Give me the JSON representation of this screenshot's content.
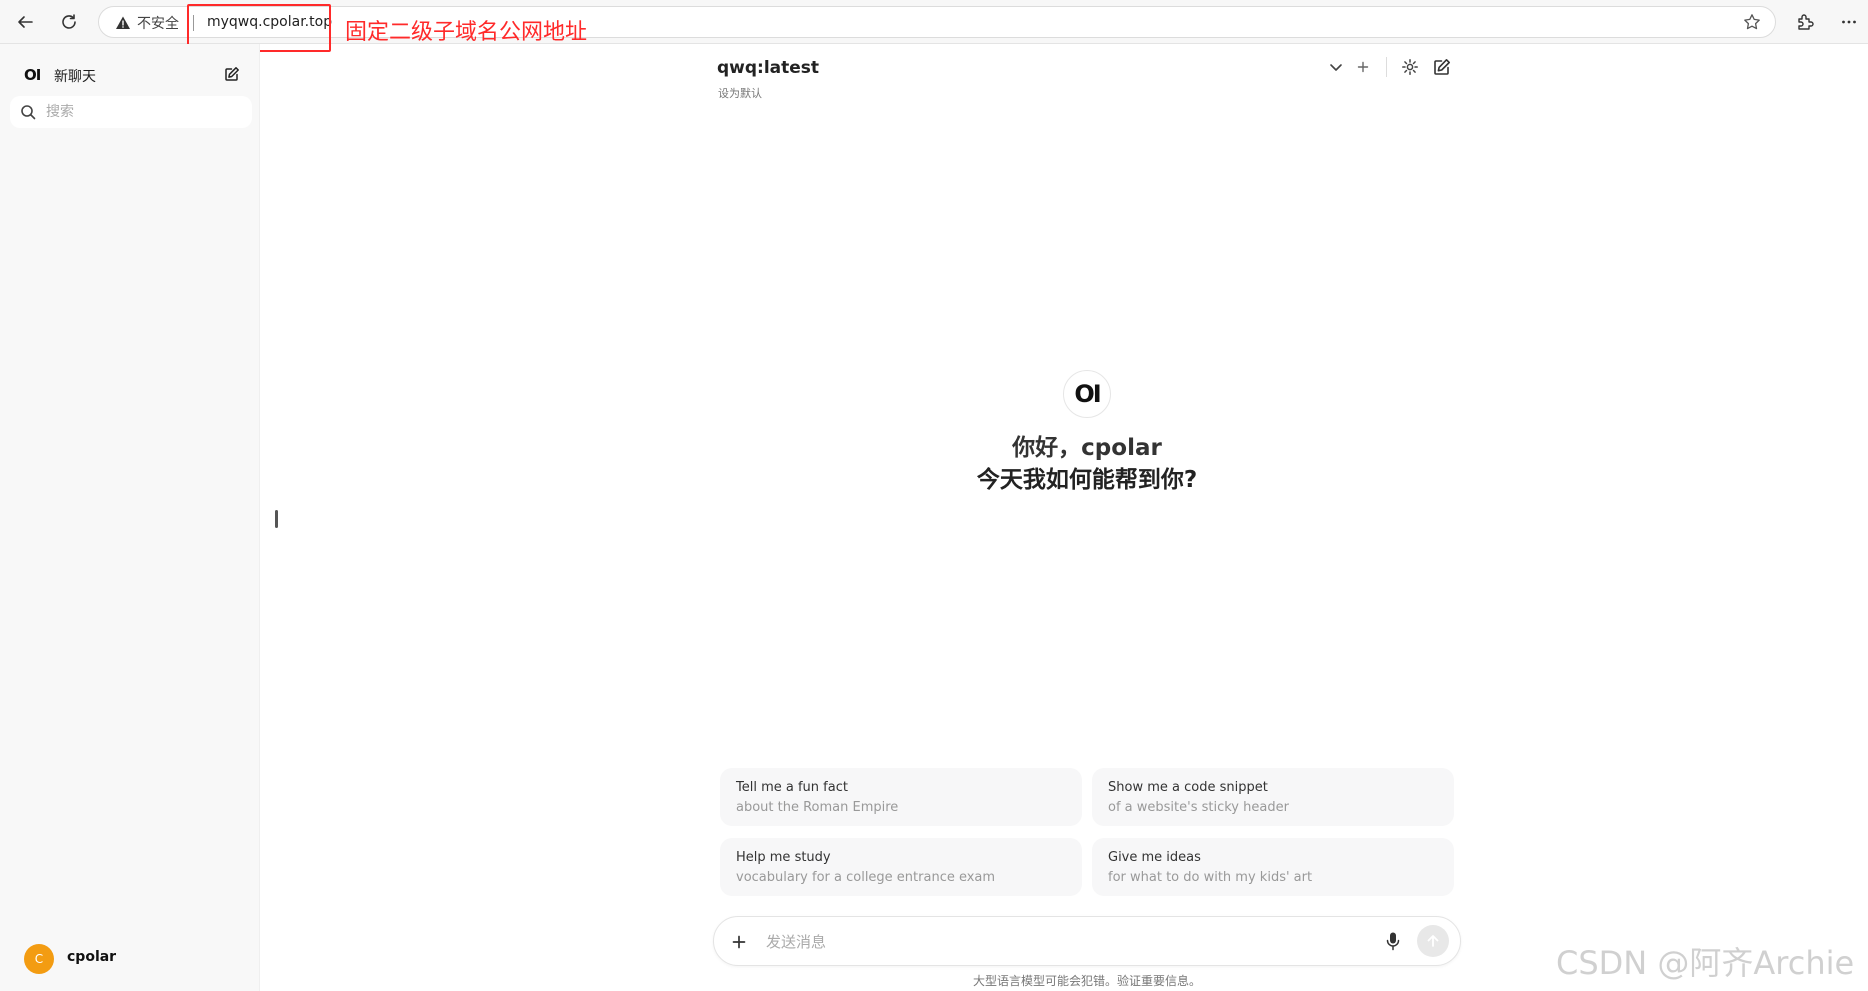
{
  "browser": {
    "insecure_label": "不安全",
    "url": "myqwq.cpolar.top",
    "annotation": "固定二级子域名公网地址"
  },
  "sidebar": {
    "logo": "OI",
    "new_chat_label": "新聊天",
    "search_placeholder": "搜索",
    "user": {
      "avatar_initial": "C",
      "name": "cpolar",
      "avatar_color": "#f39c12"
    }
  },
  "header": {
    "model_name": "qwq:latest",
    "set_default_label": "设为默认"
  },
  "welcome": {
    "logo": "OI",
    "greeting": "你好，cpolar",
    "help_text": "今天我如何能帮到你?"
  },
  "suggestions": [
    {
      "title": "Tell me a fun fact",
      "subtitle": "about the Roman Empire"
    },
    {
      "title": "Show me a code snippet",
      "subtitle": "of a website's sticky header"
    },
    {
      "title": "Help me study",
      "subtitle": "vocabulary for a college entrance exam"
    },
    {
      "title": "Give me ideas",
      "subtitle": "for what to do with my kids' art"
    }
  ],
  "composer": {
    "placeholder": "发送消息",
    "disclaimer": "大型语言模型可能会犯错。验证重要信息。"
  },
  "watermark": "CSDN @阿齐Archie",
  "colors": {
    "annotation_red": "#ff2a2a",
    "avatar_orange": "#f39c12"
  }
}
